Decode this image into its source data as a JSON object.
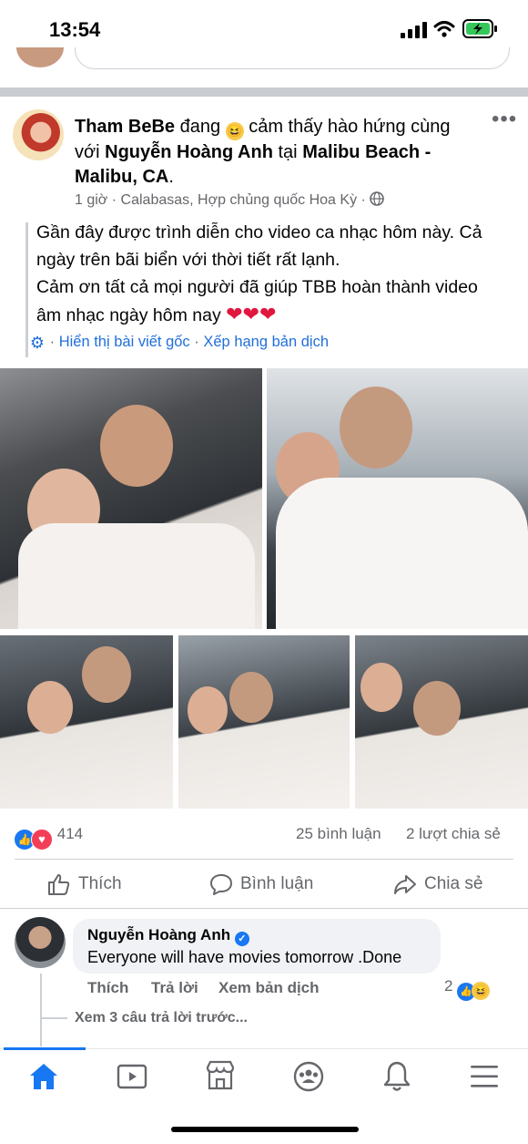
{
  "status_bar": {
    "time": "13:54"
  },
  "post": {
    "author": "Tham BeBe",
    "feeling_pre": "đang",
    "feeling_text": "cảm thấy hào hứng cùng",
    "with_pre": "với",
    "tagged": "Nguyễn Hoàng Anh",
    "at_pre": "tại",
    "place": "Malibu Beach -",
    "place2": "Malibu, CA",
    "time_ago": "1 giờ",
    "location": "Calabasas, Hợp chủng quốc Hoa Kỳ",
    "text_line1": "Gần đây được trình diễn cho video ca nhạc hôm này. Cả",
    "text_line2": "ngày trên bãi biển với thời tiết rất lạnh.",
    "text_line3": "Cảm ơn tất cả mọi người đã giúp TBB hoàn thành video",
    "text_line4": "âm nhạc ngày hôm nay",
    "show_original": "Hiển thị bài viết gốc",
    "rate_translation": "Xếp hạng bản dịch"
  },
  "stats": {
    "reactions": "414",
    "comments": "25 bình luận",
    "shares": "2 lượt chia sẻ"
  },
  "actions": {
    "like": "Thích",
    "comment": "Bình luận",
    "share": "Chia sẻ"
  },
  "comment": {
    "author": "Nguyễn Hoàng Anh",
    "text": "Everyone will have movies tomorrow .Done",
    "like": "Thích",
    "reply": "Trả lời",
    "translate": "Xem bản dịch",
    "reaction_count": "2",
    "view_previous": "Xem 3 câu trả lời trước..."
  },
  "colors": {
    "accent": "#1877f2",
    "link": "#216fdb",
    "secondary_text": "#65676b"
  },
  "icons": [
    "home-icon",
    "watch-icon",
    "marketplace-icon",
    "groups-icon",
    "bell-icon",
    "menu-icon"
  ]
}
